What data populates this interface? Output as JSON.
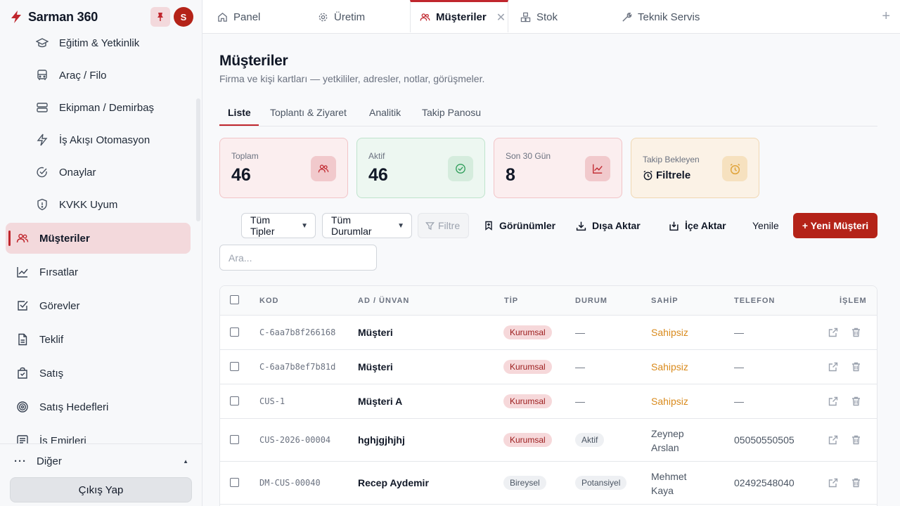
{
  "brand": {
    "name": "Sarman 360",
    "avatar_initial": "S"
  },
  "sidebar": {
    "items": [
      {
        "label": "Eğitim & Yetkinlik",
        "icon": "graduation-cap-icon"
      },
      {
        "label": "Araç / Filo",
        "icon": "bus-icon"
      },
      {
        "label": "Ekipman / Demirbaş",
        "icon": "server-icon"
      },
      {
        "label": "İş Akışı Otomasyon",
        "icon": "bolt-icon"
      },
      {
        "label": "Onaylar",
        "icon": "check-circle-icon"
      },
      {
        "label": "KVKK Uyum",
        "icon": "shield-icon"
      },
      {
        "label": "Müşteriler",
        "icon": "users-icon"
      },
      {
        "label": "Fırsatlar",
        "icon": "chart-line-icon"
      },
      {
        "label": "Görevler",
        "icon": "checkbox-icon"
      },
      {
        "label": "Teklif",
        "icon": "document-icon"
      },
      {
        "label": "Satış",
        "icon": "shopping-bag-icon"
      },
      {
        "label": "Satış Hedefleri",
        "icon": "target-icon"
      },
      {
        "label": "İş Emirleri",
        "icon": "list-icon"
      }
    ],
    "other_label": "Diğer",
    "logout_label": "Çıkış Yap"
  },
  "tabs": [
    {
      "label": "Panel",
      "icon": "home-icon"
    },
    {
      "label": "Üretim",
      "icon": "gear-icon"
    },
    {
      "label": "Müşteriler",
      "icon": "users-icon"
    },
    {
      "label": "Stok",
      "icon": "boxes-icon"
    },
    {
      "label": "Teknik Servis",
      "icon": "wrench-icon"
    }
  ],
  "page": {
    "title": "Müşteriler",
    "subtitle": "Firma ve kişi kartları — yetkililer, adresler, notlar, görüşmeler.",
    "subtabs": [
      "Liste",
      "Toplantı & Ziyaret",
      "Analitik",
      "Takip Panosu"
    ]
  },
  "cards": [
    {
      "title": "Toplam",
      "value": "46",
      "icon": "users-icon"
    },
    {
      "title": "Aktif",
      "value": "46",
      "icon": "check-circle-icon"
    },
    {
      "title": "Son 30 Gün",
      "value": "8",
      "icon": "chart-line-icon"
    },
    {
      "title": "Takip Bekleyen",
      "value": "Filtrele",
      "icon": "alarm-clock-icon"
    }
  ],
  "toolbar": {
    "type_select": "Tüm Tipler",
    "status_select": "Tüm Durumlar",
    "filter_label": "Filtre",
    "views_label": "Görünümler",
    "export_label": "Dışa Aktar",
    "import_label": "İçe Aktar",
    "refresh_label": "Yenile",
    "new_label": "+ Yeni Müşteri",
    "search_placeholder": "Ara..."
  },
  "table": {
    "headers": [
      "KOD",
      "AD / ÜNVAN",
      "TİP",
      "DURUM",
      "SAHİP",
      "TELEFON",
      "İŞLEM"
    ],
    "rows": [
      {
        "code": "C-6aa7b8f266168",
        "name": "Müşteri",
        "type": "Kurumsal",
        "status": "—",
        "owner": "Sahipsiz",
        "phone": "—"
      },
      {
        "code": "C-6aa7b8ef7b81d",
        "name": "Müşteri",
        "type": "Kurumsal",
        "status": "—",
        "owner": "Sahipsiz",
        "phone": "—"
      },
      {
        "code": "CUS-1",
        "name": "Müşteri A",
        "type": "Kurumsal",
        "status": "—",
        "owner": "Sahipsiz",
        "phone": "—"
      },
      {
        "code": "CUS-2026-00004",
        "name": "hghjgjhjhj",
        "type": "Kurumsal",
        "status": "Aktif",
        "owner": "Zeynep Arslan",
        "phone": "05050550505"
      },
      {
        "code": "DM-CUS-00040",
        "name": "Recep Aydemir",
        "type": "Bireysel",
        "status": "Potansiyel",
        "owner": "Mehmet Kaya",
        "phone": "02492548040"
      }
    ]
  },
  "colors": {
    "accent": "#c0262d",
    "primary_button": "#b42318",
    "owner_none": "#d98a1c"
  }
}
